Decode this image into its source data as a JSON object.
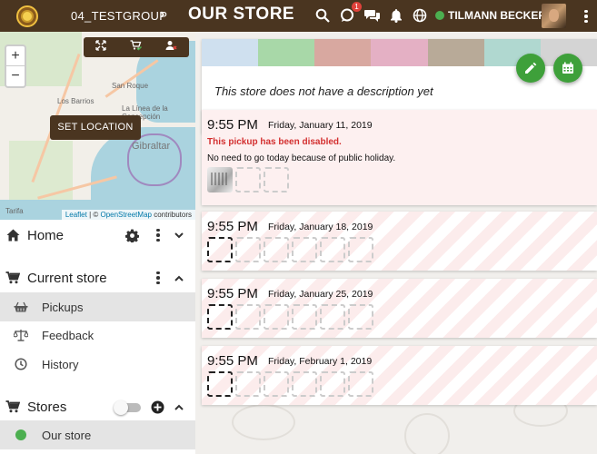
{
  "topbar": {
    "group": "04_TESTGROUP",
    "title": "OUR STORE",
    "notification_count": "1",
    "user_name": "TILMANN BECKER",
    "colors": {
      "bar": "#4a3520",
      "online": "#4caf50",
      "badge": "#e0423b"
    }
  },
  "map": {
    "set_location": "SET LOCATION",
    "zoom_in": "+",
    "zoom_out": "−",
    "places": [
      "San Roque",
      "Los Barrios",
      "La Línea de la Concepción",
      "Gibraltar",
      "Tarifa"
    ],
    "attribution": {
      "leaflet": "Leaflet",
      "sep": " | © ",
      "osm": "OpenStreetMap",
      "suffix": " contributors"
    }
  },
  "sidebar": {
    "home": "Home",
    "current_store": "Current store",
    "items": [
      {
        "label": "Pickups",
        "icon": "basket-icon",
        "active": true
      },
      {
        "label": "Feedback",
        "icon": "balance-scale-icon",
        "active": false
      },
      {
        "label": "History",
        "icon": "clock-icon",
        "active": false
      }
    ],
    "stores": "Stores",
    "store_list": [
      {
        "label": "Our store",
        "status_color": "#4caf50"
      }
    ]
  },
  "store": {
    "description": "This store does not have a description yet",
    "swatch_colors": [
      "#cfe0ef",
      "#a8d8a8",
      "#d8a8a0",
      "#e4b0c4",
      "#b8aa98",
      "#b0d8d0",
      "#d4d4d4"
    ]
  },
  "pickups": [
    {
      "time": "9:55 PM",
      "date": "Friday, January 11, 2019",
      "warning": "This pickup has been disabled.",
      "note": "No need to go today because of public holiday.",
      "slots": 3
    },
    {
      "time": "9:55 PM",
      "date": "Friday, January 18, 2019",
      "slots": 6
    },
    {
      "time": "9:55 PM",
      "date": "Friday, January 25, 2019",
      "slots": 6
    },
    {
      "time": "9:55 PM",
      "date": "Friday, February 1, 2019",
      "slots": 6
    }
  ]
}
